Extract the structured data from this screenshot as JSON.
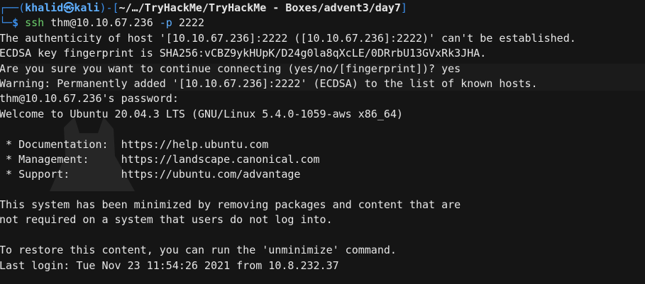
{
  "terminal": {
    "prompt": {
      "corner_top": "┌──(",
      "user": "khalid",
      "at_icon": "㉿",
      "host": "kali",
      "close_paren": ")-[",
      "path": "~/…/TryHackMe/TryHackMe - Boxes/advent3/day7",
      "close_bracket": "]",
      "corner_bottom": "└─",
      "dollar": "$",
      "command": "ssh",
      "command_args_1": " thm@10.10.67.236 ",
      "flag": "-p",
      "command_args_2": " 2222"
    },
    "output_lines": [
      "The authenticity of host '[10.10.67.236]:2222 ([10.10.67.236]:2222)' can't be established.",
      "ECDSA key fingerprint is SHA256:vCBZ9ykHUpK/D24g0la8qXcLE/0DRrbU13GVxRk3JHA.",
      "Are you sure you want to continue connecting (yes/no/[fingerprint])? yes",
      "Warning: Permanently added '[10.10.67.236]:2222' (ECDSA) to the list of known hosts.",
      "thm@10.10.67.236's password:",
      "Welcome to Ubuntu 20.04.3 LTS (GNU/Linux 5.4.0-1059-aws x86_64)",
      "",
      " * Documentation:  https://help.ubuntu.com",
      " * Management:     https://landscape.canonical.com",
      " * Support:        https://ubuntu.com/advantage",
      "",
      "This system has been minimized by removing packages and content that are",
      "not required on a system that users do not log into.",
      "",
      "To restore this content, you can run the 'unminimize' command.",
      "Last login: Tue Nov 23 11:54:26 2021 from 10.8.232.37"
    ],
    "colors": {
      "background": "#151515",
      "text": "#e6e6e6",
      "prompt_accent": "#3b8eea",
      "command": "#6ccf6c"
    }
  }
}
